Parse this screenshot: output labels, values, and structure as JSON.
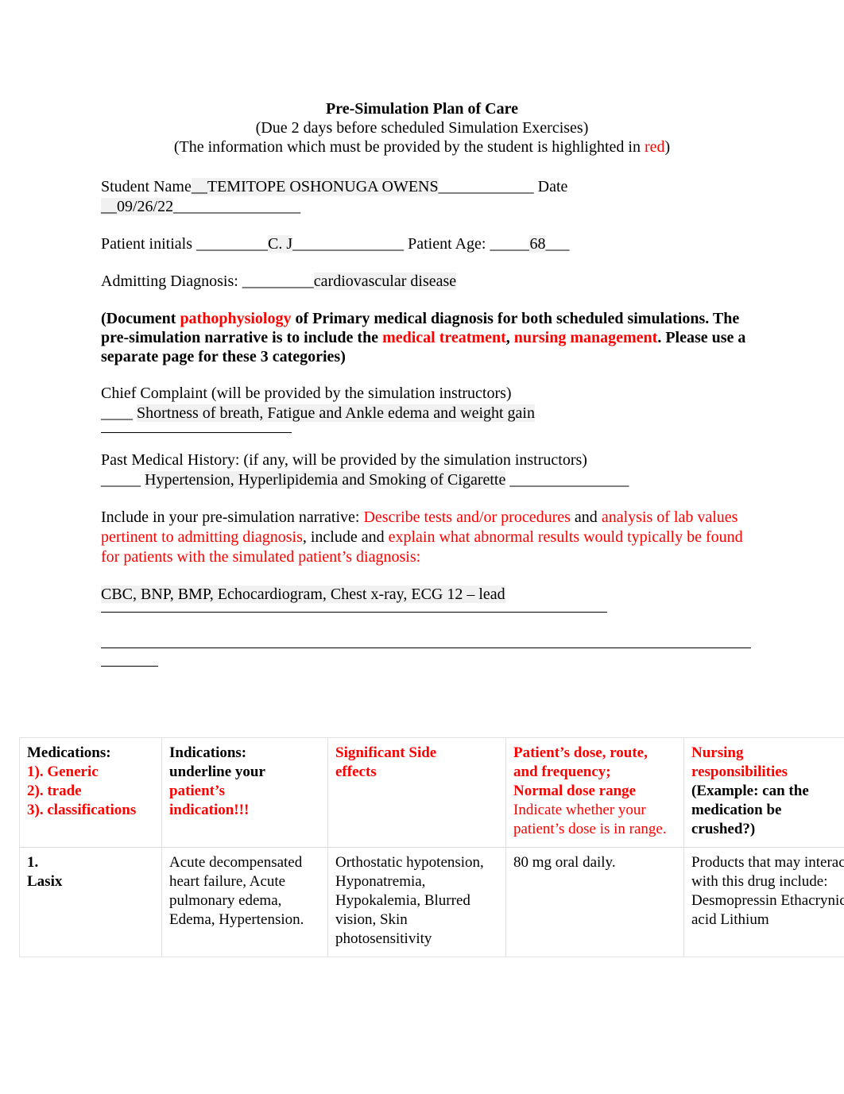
{
  "document": {
    "title": "Pre-Simulation Plan of Care",
    "subtitle_line1": "(Due 2 days before scheduled Simulation Exercises)",
    "subtitle_line2_before": "(The information which must be provided by the student is highlighted in ",
    "subtitle_line2_red": "red",
    "subtitle_line2_after": ")"
  },
  "form": {
    "student_name_label": "Student Name",
    "student_name_lead": "__",
    "student_name_value": "TEMITOPE OSHONUGA OWENS",
    "student_name_trail": "____________",
    "date_label": "Date",
    "date_lead": "__",
    "date_value": "09/26/22",
    "date_trail": "________________",
    "patient_initials_label": "Patient initials ",
    "patient_initials_lead": "_________",
    "patient_initials_value": "C. J",
    "patient_initials_trail": "______________",
    "patient_age_label": " Patient Age: ",
    "patient_age_lead": "_____",
    "patient_age_value": "68",
    "patient_age_trail": "___",
    "admitting_diagnosis_label": "Admitting Diagnosis: ",
    "admitting_diagnosis_lead": "_________",
    "admitting_diagnosis_value": "cardiovascular disease"
  },
  "instruction_block": {
    "part1": "(Document ",
    "red1": "pathophysiology",
    "part2": " of Primary medical diagnosis for both scheduled simulations. The pre-simulation narrative is to include the ",
    "red2": "medical treatment",
    "part3": ", ",
    "red3": "nursing management",
    "part4": ". Please use a separate page for these 3 categories)"
  },
  "chief_complaint": {
    "label": "Chief Complaint (will be provided by the simulation instructors)",
    "lead": "____ ",
    "value": "Shortness of breath, Fatigue and Ankle edema and weight gain"
  },
  "past_medical_history": {
    "label": "Past Medical History: (if any, will be provided by the simulation instructors)",
    "lead": " _____ ",
    "value": "Hypertension, Hyperlipidemia and Smoking of Cigarette",
    "trail": " _______________"
  },
  "narrative": {
    "black1": "Include in your pre-simulation narrative: ",
    "red1": "Describe tests and/or procedures",
    "black2": " and ",
    "red2": "analysis of lab values pertinent to admitting diagnosis",
    "black3": ", include and ",
    "red3": "explain what abnormal results would typically be found for patients with the simulated patient’s diagnosis:",
    "answer": "CBC, BNP, BMP, Echocardiogram, Chest x-ray, ECG 12 – lead"
  },
  "medication_table": {
    "headers": {
      "medications": {
        "black": "Medications:",
        "red_lines": [
          "1). Generic",
          "2). trade",
          "3). classifications"
        ]
      },
      "indications": {
        "black_lines": [
          "Indications:",
          "underline your"
        ],
        "red_lines": [
          "patient’s",
          "indication!!!"
        ]
      },
      "side_effects": {
        "red_lines": [
          "Significant Side",
          "effects"
        ]
      },
      "dose": {
        "red_bold_lines": [
          "Patient’s dose, route,",
          "and frequency;",
          "Normal dose range"
        ],
        "red_regular": "Indicate whether your patient’s dose is in range."
      },
      "nursing": {
        "red_lines": [
          "Nursing",
          "responsibilities"
        ],
        "black_lines": [
          "(Example: can the",
          "medication be",
          "crushed?)"
        ]
      }
    },
    "rows": [
      {
        "medication_number": "1.",
        "medication_name": "Lasix",
        "indications": "Acute decompensated heart failure, Acute pulmonary edema, Edema, Hypertension.",
        "side_effects": "Orthostatic hypotension, Hyponatremia, Hypokalemia, Blurred vision, Skin photosensitivity",
        "dose": "80 mg oral daily.",
        "nursing": "Products that may interact with this drug include: Desmopressin Ethacrynic acid Lithium"
      }
    ]
  },
  "colors": {
    "red": "#ff0000",
    "text": "#000000",
    "highlight": "#f1f1f1",
    "table_border": "#e2e2e2"
  }
}
